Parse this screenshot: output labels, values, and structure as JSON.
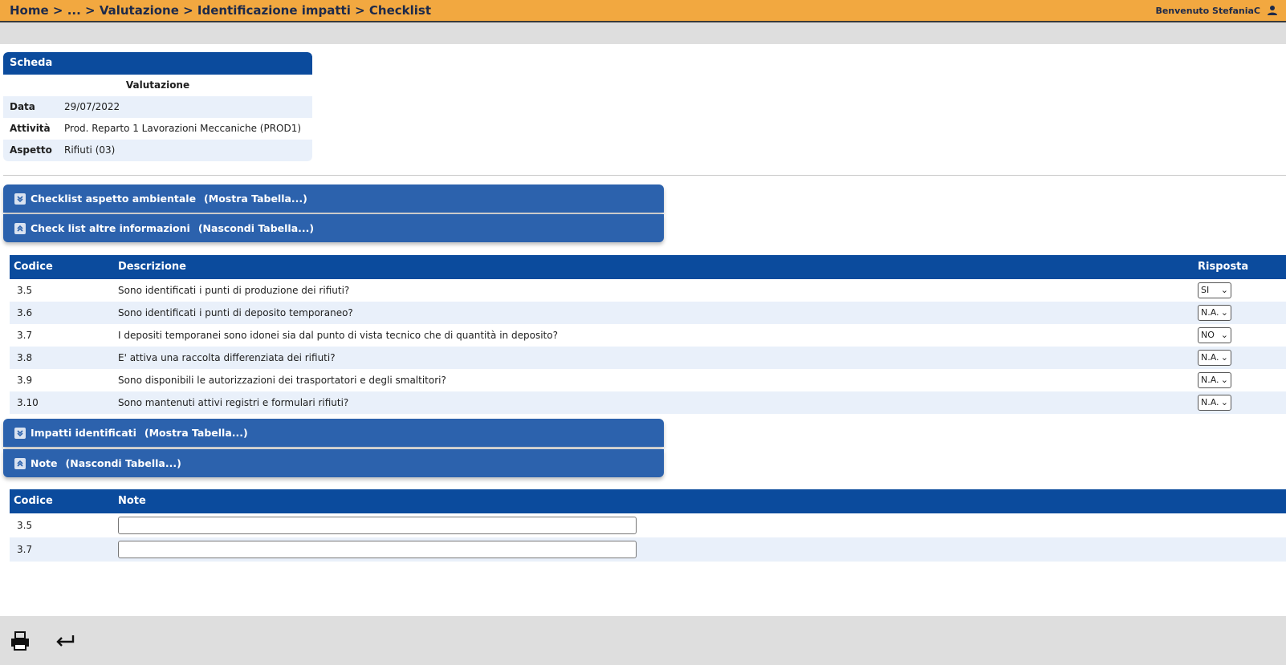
{
  "header": {
    "breadcrumb": [
      "Home",
      " > ",
      "...",
      " > ",
      "Valutazione",
      " > ",
      "Identificazione impatti",
      " > ",
      "Checklist"
    ],
    "welcome": "Benvenuto StefaniaC"
  },
  "scheda": {
    "title": "Scheda",
    "subtitle": "Valutazione",
    "rows": [
      {
        "label": "Data",
        "value": "29/07/2022"
      },
      {
        "label": "Attività",
        "value": "Prod. Reparto 1 Lavorazioni Meccaniche (PROD1)"
      },
      {
        "label": "Aspetto",
        "value": "Rifiuti (03)"
      }
    ]
  },
  "sections": {
    "checklist_ambientale": {
      "title": "Checklist aspetto ambientale",
      "action": "(Mostra Tabella...)"
    },
    "altre_info": {
      "title": "Check list altre informazioni",
      "action": "(Nascondi Tabella...)"
    },
    "impatti": {
      "title": "Impatti identificati",
      "action": "(Mostra Tabella...)"
    },
    "note": {
      "title": "Note",
      "action": "(Nascondi Tabella...)"
    }
  },
  "checklist_table": {
    "headers": {
      "code": "Codice",
      "desc": "Descrizione",
      "resp": "Risposta"
    },
    "rows": [
      {
        "code": "3.5",
        "desc": "Sono identificati i punti di produzione dei rifiuti?",
        "resp": "SI"
      },
      {
        "code": "3.6",
        "desc": "Sono identificati i punti di deposito temporaneo?",
        "resp": "N.A."
      },
      {
        "code": "3.7",
        "desc": "I depositi temporanei sono idonei sia dal punto di vista tecnico che di quantità in deposito?",
        "resp": "NO"
      },
      {
        "code": "3.8",
        "desc": "E' attiva una raccolta differenziata dei rifiuti?",
        "resp": "N.A."
      },
      {
        "code": "3.9",
        "desc": "Sono disponibili le autorizzazioni dei trasportatori e degli smaltitori?",
        "resp": "N.A."
      },
      {
        "code": "3.10",
        "desc": "Sono mantenuti attivi registri e formulari rifiuti?",
        "resp": "N.A."
      }
    ]
  },
  "note_table": {
    "headers": {
      "code": "Codice",
      "note": "Note"
    },
    "rows": [
      {
        "code": "3.5",
        "note": ""
      },
      {
        "code": "3.7",
        "note": ""
      }
    ]
  },
  "icons": {
    "user": "user-icon",
    "expand": "chevron-double-down-icon",
    "collapse": "chevron-double-up-icon",
    "print": "print-icon",
    "back": "return-arrow-icon"
  },
  "colors": {
    "topbar": "#f2a840",
    "header_blue": "#0b4b9d",
    "bar_blue": "#2c62ad",
    "row_alt": "#e9f0fa"
  }
}
